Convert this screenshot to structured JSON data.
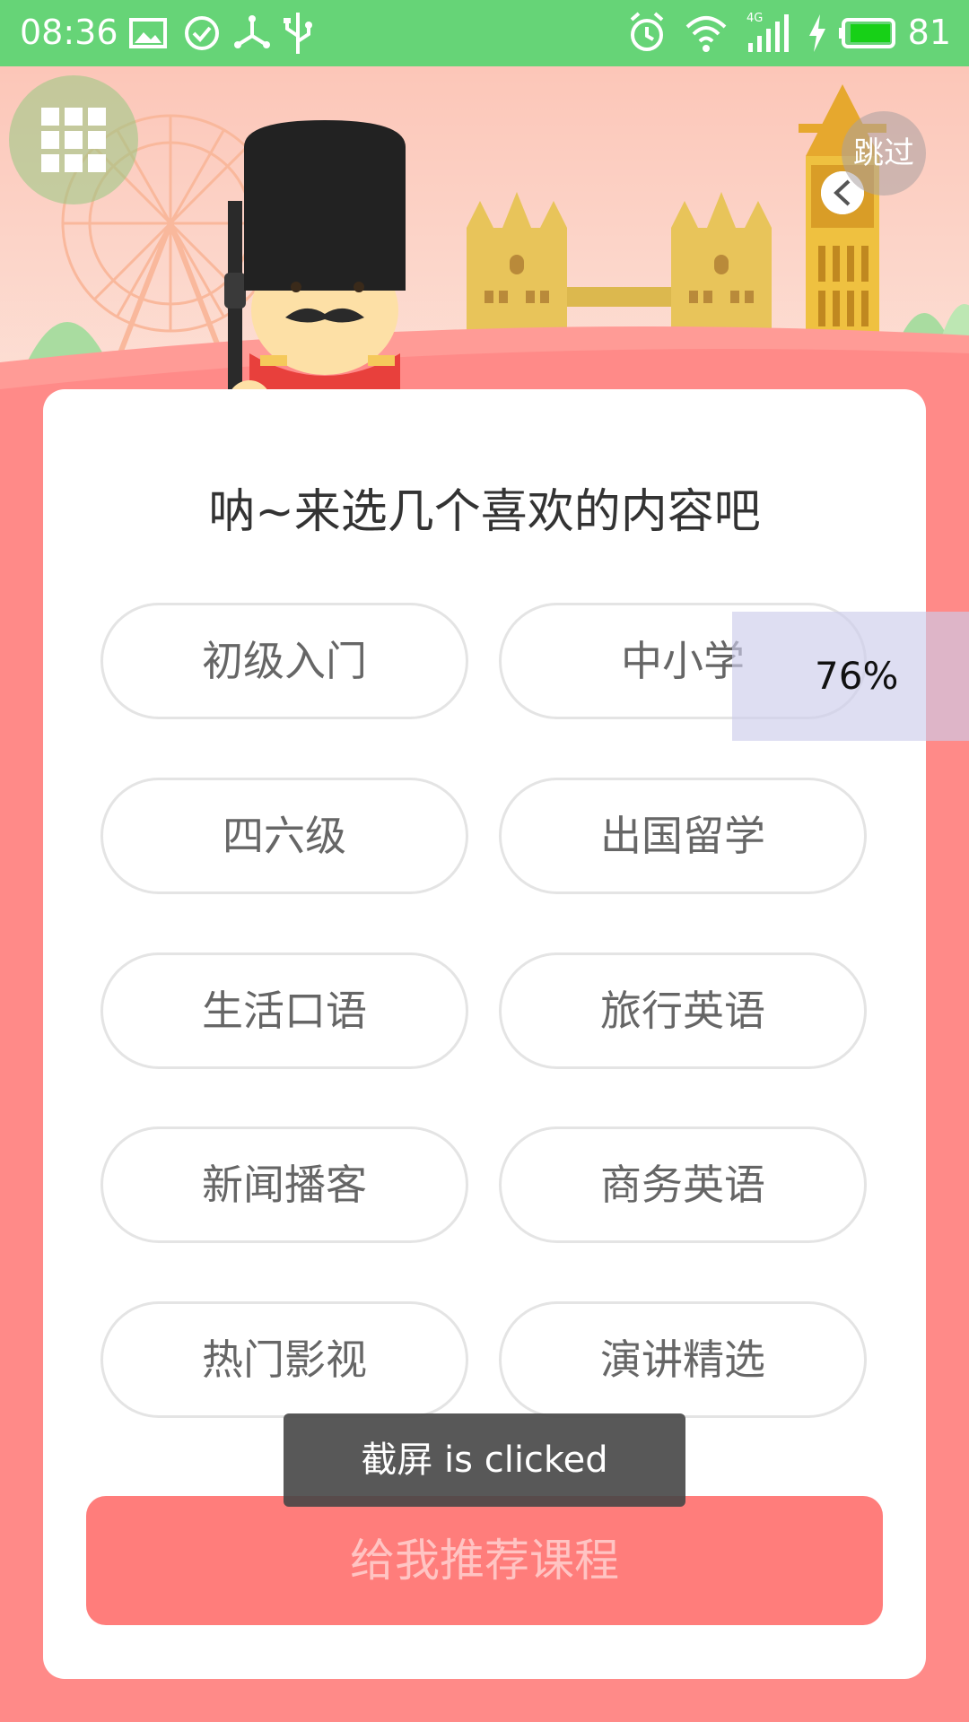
{
  "status_bar": {
    "time": "08:36",
    "battery": "81",
    "network": "4G",
    "color": "#66d477"
  },
  "header": {
    "skip_label": "跳过",
    "menu_icon": "grid-icon",
    "clock_back_icon": "chevron-left-icon"
  },
  "content": {
    "title": "呐~来选几个喜欢的内容吧",
    "options": [
      [
        "初级入门",
        "中小学"
      ],
      [
        "四六级",
        "出国留学"
      ],
      [
        "生活口语",
        "旅行英语"
      ],
      [
        "新闻播客",
        "商务英语"
      ],
      [
        "热门影视",
        "演讲精选"
      ]
    ],
    "recommend_label": "给我推荐课程"
  },
  "overlay": {
    "progress_label": "76%"
  },
  "toast": {
    "message": "截屏 is clicked"
  },
  "colors": {
    "accent": "#ff7d7b",
    "background": "#ff8a88"
  }
}
